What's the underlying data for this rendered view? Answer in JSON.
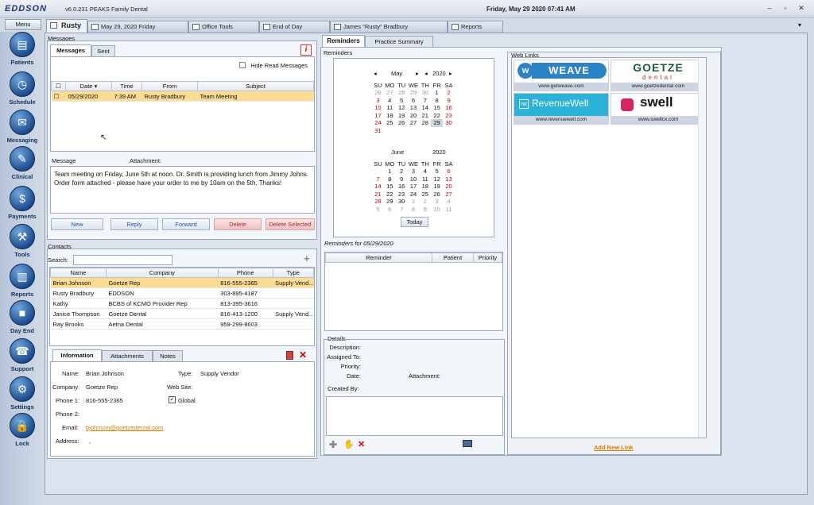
{
  "app": {
    "logo": "EDDSON",
    "version": "v6.0.231  PEAKS Family Dental",
    "datetime": "Friday, May 29 2020 07:41 AM",
    "menu": "Menu"
  },
  "nav": [
    {
      "label": "Patients",
      "icon": "folder-icon",
      "glyph": "▤"
    },
    {
      "label": "Schedule",
      "icon": "schedule-icon",
      "glyph": "◷"
    },
    {
      "label": "Messaging",
      "icon": "messaging-icon",
      "glyph": "✉"
    },
    {
      "label": "Clinical",
      "icon": "clinical-icon",
      "glyph": "✎"
    },
    {
      "label": "Payments",
      "icon": "payments-icon",
      "glyph": "$"
    },
    {
      "label": "Tools",
      "icon": "tools-icon",
      "glyph": "⚒"
    },
    {
      "label": "Reports",
      "icon": "reports-icon",
      "glyph": "▥"
    },
    {
      "label": "Day End",
      "icon": "day-end-icon",
      "glyph": "■"
    },
    {
      "label": "Support",
      "icon": "support-icon",
      "glyph": "☎"
    },
    {
      "label": "Settings",
      "icon": "settings-icon",
      "glyph": "⚙"
    },
    {
      "label": "Lock",
      "icon": "lock-icon",
      "glyph": "🔒"
    }
  ],
  "tabs": {
    "rusty": "Rusty",
    "date": "May 29, 2020 Friday",
    "office": "Office Tools",
    "endday": "End of Day",
    "patient": "James \"Rusty\" Bradbury",
    "reports": "Reports"
  },
  "messages": {
    "group": "Messages",
    "tab_messages": "Messages",
    "tab_sent": "Sent",
    "hide_read": "Hide Read Messages",
    "cols": [
      "Date",
      "Time",
      "From",
      "Subject"
    ],
    "row": {
      "date": "05/29/2020",
      "time": "7:39 AM",
      "from": "Rusty Bradbury",
      "subject": "Team Meeting"
    },
    "message_label": "Message",
    "attachment_label": "Attachment:",
    "body": "Team meeting on Friday, June 5th at noon.  Dr. Smith is providing lunch from Jimmy Johns.   Order form attached - please have your order to me by 10am on the 5th.  Thanks!",
    "btn_new": "New",
    "btn_reply": "Reply",
    "btn_forward": "Forward",
    "btn_delete": "Delete",
    "btn_delete_selected": "Delete Selected"
  },
  "contacts": {
    "group": "Contacts",
    "search_label": "Search:",
    "cols": [
      "Name",
      "Company",
      "Phone",
      "Type"
    ],
    "rows": [
      [
        "Brian Johnson",
        "Goetze Rep",
        "816-555-2365",
        "Supply Vend..."
      ],
      [
        "Rusty Bradbury",
        "EDDSON",
        "303-895-4187",
        ""
      ],
      [
        "Kathy",
        "BCBS of KCMO Provider Rep",
        "813-395-3616",
        ""
      ],
      [
        "Janice Thompson",
        "Goetze Dental",
        "816-413-1200",
        "Supply Vend..."
      ],
      [
        "Ray Brooks",
        "Aetna Dental",
        "959-299-8603",
        ""
      ]
    ],
    "tab_info": "Information",
    "tab_attach": "Attachments",
    "tab_notes": "Notes",
    "info": {
      "name_l": "Name:",
      "name": "Brian Johnson",
      "type_l": "Type:",
      "type": "Supply Vendor",
      "company_l": "Company:",
      "company": "Goetze Rep",
      "website_l": "Web Site:",
      "phone1_l": "Phone 1:",
      "phone1": "816-555-2365",
      "global": "Global",
      "phone2_l": "Phone 2:",
      "email_l": "Email:",
      "email": "bjohnson@goetzedental.com",
      "address_l": "Address:",
      "address": ","
    }
  },
  "reminders": {
    "tab_rem": "Reminders",
    "tab_summary": "Practice Summary",
    "group": "Reminders",
    "month1": "May",
    "year1": "2020",
    "month2": "June",
    "year2": "2020",
    "days": [
      "SU",
      "MO",
      "TU",
      "WE",
      "TH",
      "FR",
      "SA"
    ],
    "today_btn": "Today",
    "for_label": "Reminders for 05/29/2020",
    "cols": [
      "Reminder",
      "Patient",
      "Priority"
    ],
    "details": "Details",
    "description": "Description:",
    "assigned": "Assigned To:",
    "priority": "Priority:",
    "date": "Date:",
    "attachment": "Attachment:",
    "created": "Created By:"
  },
  "cal_may": [
    [
      "26",
      "27",
      "28",
      "29",
      "30",
      "1",
      "2"
    ],
    [
      "3",
      "4",
      "5",
      "6",
      "7",
      "8",
      "9"
    ],
    [
      "10",
      "11",
      "12",
      "13",
      "14",
      "15",
      "16"
    ],
    [
      "17",
      "18",
      "19",
      "20",
      "21",
      "22",
      "23"
    ],
    [
      "24",
      "25",
      "26",
      "27",
      "28",
      "29",
      "30"
    ],
    [
      "31",
      "",
      "",
      "",
      "",
      "",
      ""
    ]
  ],
  "cal_june": [
    [
      "",
      "1",
      "2",
      "3",
      "4",
      "5",
      "6"
    ],
    [
      "7",
      "8",
      "9",
      "10",
      "11",
      "12",
      "13"
    ],
    [
      "14",
      "15",
      "16",
      "17",
      "18",
      "19",
      "20"
    ],
    [
      "21",
      "22",
      "23",
      "24",
      "25",
      "26",
      "27"
    ],
    [
      "28",
      "29",
      "30",
      "1",
      "2",
      "3",
      "4"
    ],
    [
      "5",
      "6",
      "7",
      "8",
      "9",
      "10",
      "11"
    ]
  ],
  "weblinks": {
    "group": "Web Links",
    "weave": "WEAVE",
    "weave_url": "www.getweave.com",
    "goetze": "GOETZE",
    "goetze_sub": "dental",
    "goetze_url": "www.goetzedental.com",
    "revenuewell": "RevenueWell",
    "revenuewell_url": "www.revenuewell.com",
    "swell": "swell",
    "swell_url": "www.swellcx.com",
    "add": "Add New Link"
  }
}
